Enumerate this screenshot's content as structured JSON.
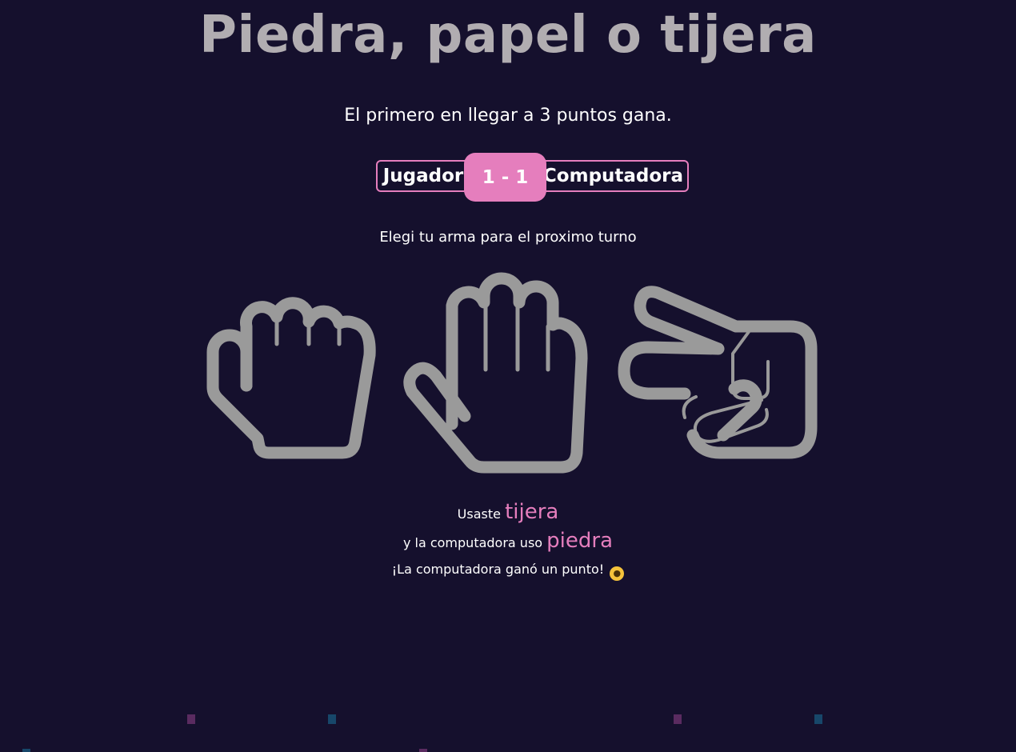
{
  "game": {
    "title": "Piedra, papel o tijera",
    "subtitle": "El primero en llegar a 3 puntos gana."
  },
  "scoreboard": {
    "player_label": "Jugador",
    "score": "1 - 1",
    "computer_label": "Computadora"
  },
  "prompt": "Elegi tu arma para el proximo turno",
  "weapons": [
    {
      "name": "piedra",
      "icon": "rock-hand-icon"
    },
    {
      "name": "papel",
      "icon": "paper-hand-icon"
    },
    {
      "name": "tijera",
      "icon": "scissors-hand-icon"
    }
  ],
  "result": {
    "line1_prefix": "Usaste",
    "player_choice": "tijera",
    "line2_prefix": "y la computadora uso",
    "computer_choice": "piedra",
    "outcome": "¡La computadora ganó un punto!",
    "outcome_emoji": "crying-face-emoji"
  },
  "colors": {
    "background": "#15102d",
    "accent": "#e57ebd",
    "title": "#b1adb1",
    "icon": "#9a9a9a"
  }
}
